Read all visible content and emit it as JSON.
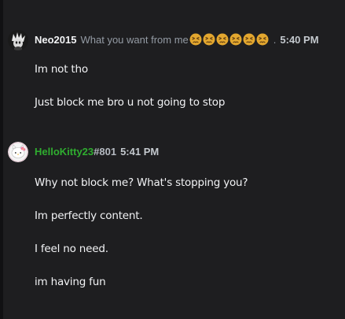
{
  "messages": [
    {
      "username": "Neo2015",
      "status": "What you want from me",
      "status_emoji_count": 6,
      "separator": ".",
      "timestamp": "5:40 PM",
      "lines": [
        "Im not tho",
        "Just block me bro u not going to stop"
      ]
    },
    {
      "username": "HelloKitty23",
      "discriminator": "#801",
      "timestamp": "5:41 PM",
      "lines": [
        "Why not block me? What's stopping you?",
        "Im perfectly content.",
        "I feel no need.",
        "im having fun"
      ]
    }
  ],
  "colors": {
    "background": "#1e1e20",
    "username_default": "#f2f3f5",
    "username_green": "#2fad2f",
    "muted": "#949ba4",
    "emoji_face": "#e3a72f"
  },
  "icons": {
    "avatar_1": "spiky-hair-character-avatar",
    "avatar_2": "hello-kitty-avatar",
    "status_emoji": "persevering-face-emoji"
  }
}
